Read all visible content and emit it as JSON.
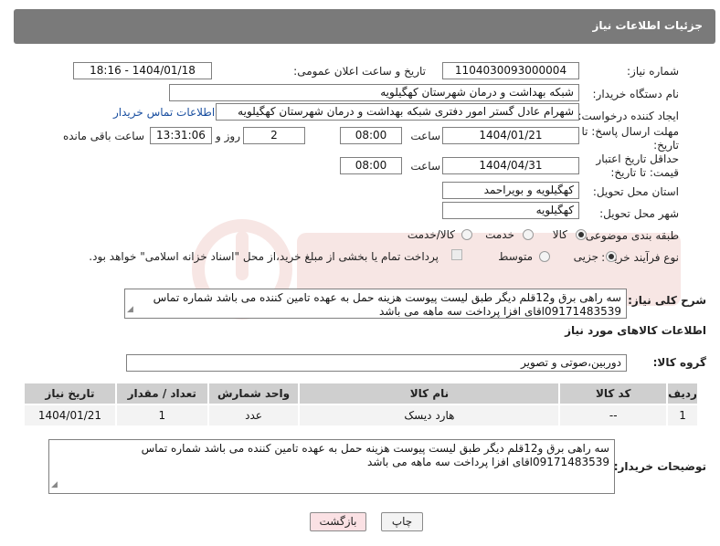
{
  "header": {
    "title": "جزئیات اطلاعات نیاز"
  },
  "need_number": {
    "label": "شماره نیاز:",
    "value": "1104030093000004"
  },
  "announce": {
    "label": "تاریخ و ساعت اعلان عمومی:",
    "value": "1404/01/18 - 18:16"
  },
  "buyer": {
    "label": "نام دستگاه خریدار:",
    "value": "شبکه بهداشت و درمان شهرستان کهگیلویه"
  },
  "creator": {
    "label": "ایجاد کننده درخواست:",
    "value": "شهرام عادل گستر امور دفتری شبکه بهداشت و درمان شهرستان کهگیلویه",
    "contact_link": "اطلاعات تماس خریدار"
  },
  "deadline": {
    "label": "مهلت ارسال پاسخ: تا تاریخ:",
    "date": "1404/01/21",
    "time_label": "ساعت",
    "time": "08:00",
    "days": "2",
    "days_label": "روز و",
    "remaining": "13:31:06",
    "remaining_label": "ساعت باقی مانده"
  },
  "validity": {
    "label": "حداقل تاریخ اعتبار قیمت: تا تاریخ:",
    "date": "1404/04/31",
    "time_label": "ساعت",
    "time": "08:00"
  },
  "province": {
    "label": "استان محل تحویل:",
    "value": "کهگیلویه و بویراحمد"
  },
  "city": {
    "label": "شهر محل تحویل:",
    "value": "کهگیلویه"
  },
  "category": {
    "label": "طبقه بندی موضوعی:",
    "options": [
      "کالا",
      "خدمت",
      "کالا/خدمت"
    ],
    "selected": "کالا"
  },
  "purchase_type": {
    "label": "نوع فرآیند خرید :",
    "options": [
      "جزیی",
      "متوسط"
    ],
    "selected": "جزیی",
    "checkbox_text": "پرداخت تمام یا بخشی از مبلغ خرید،از محل \"اسناد خزانه اسلامی\" خواهد بود."
  },
  "description": {
    "label": "شرح کلی نیاز:",
    "line1": "سه راهی برق  و12قلم دیگر طبق لیست پیوست هزینه حمل به عهده تامین کننده می باشد شماره تماس",
    "line2": "09171483539اقای افزا پرداخت سه ماهه می باشد"
  },
  "goods_section": {
    "title": "اطلاعات کالاهای مورد نیاز"
  },
  "goods_group": {
    "label": "گروه کالا:",
    "value": "دوربین،صوتی و تصویر"
  },
  "table": {
    "headers": [
      "ردیف",
      "کد کالا",
      "نام کالا",
      "واحد شمارش",
      "تعداد / مقدار",
      "تاریخ نیاز"
    ],
    "rows": [
      [
        "1",
        "--",
        "هارد دیسک",
        "عدد",
        "1",
        "1404/01/21"
      ]
    ]
  },
  "buyer_notes": {
    "label": "توضیحات خریدار:",
    "line1": "سه راهی برق  و12قلم دیگر طبق لیست پیوست هزینه حمل به عهده تامین کننده می باشد شماره تماس",
    "line2": "09171483539اقای افزا پرداخت سه ماهه می باشد"
  },
  "buttons": {
    "print": "چاپ",
    "back": "بازگشت"
  }
}
